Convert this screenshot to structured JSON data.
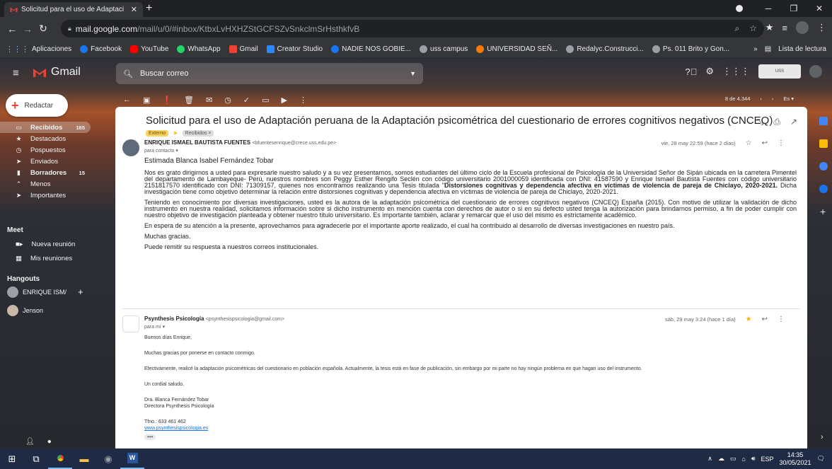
{
  "browser": {
    "tab_title": "Solicitud para el uso de Adaptaci",
    "tab_close": "✕",
    "new_tab": "+",
    "url_host": "mail.google.com",
    "url_path": "/mail/u/0/#inbox/KtbxLvHXHZStGCFSZvSnkclmSrHsthkfvB",
    "bookmarks": [
      {
        "label": "Aplicaciones",
        "color": "#fbbc04"
      },
      {
        "label": "Facebook",
        "color": "#1877f2"
      },
      {
        "label": "YouTube",
        "color": "#ff0000"
      },
      {
        "label": "WhatsApp",
        "color": "#25d366"
      },
      {
        "label": "Gmail",
        "color": "#ea4335"
      },
      {
        "label": "Creator Studio",
        "color": "#2d88ff"
      },
      {
        "label": "NADIE NOS GOBIE...",
        "color": "#1877f2"
      },
      {
        "label": "uss campus",
        "color": "#9aa0a6"
      },
      {
        "label": "UNIVERSIDAD SEÑ...",
        "color": "#f57c00"
      },
      {
        "label": "Redalyc.Construcci...",
        "color": "#9aa0a6"
      },
      {
        "label": "Ps. 011 Brito y Gon...",
        "color": "#9aa0a6"
      }
    ],
    "bookmarks_more": "»",
    "reading_list": "Lista de lectura"
  },
  "gmail": {
    "app_name": "Gmail",
    "search_placeholder": "Buscar correo",
    "compose": "Redactar",
    "nav": [
      {
        "label": "Recibidos",
        "count": "165",
        "icon": "inbox-icon",
        "glyph": "▭",
        "active": true
      },
      {
        "label": "Destacados",
        "count": "",
        "icon": "star-icon",
        "glyph": "★",
        "active": false
      },
      {
        "label": "Pospuestos",
        "count": "",
        "icon": "snooze-icon",
        "glyph": "◷",
        "active": false
      },
      {
        "label": "Enviados",
        "count": "",
        "icon": "send-icon",
        "glyph": "➤",
        "active": false
      },
      {
        "label": "Borradores",
        "count": "15",
        "icon": "draft-icon",
        "glyph": "▮",
        "active": false
      },
      {
        "label": "Menos",
        "count": "",
        "icon": "chevron-up-icon",
        "glyph": "⌃",
        "active": false
      },
      {
        "label": "Importantes",
        "count": "",
        "icon": "important-icon",
        "glyph": "➤",
        "active": false
      }
    ],
    "meet_title": "Meet",
    "meet_new": "Nueva reunión",
    "meet_mine": "Mis reuniones",
    "hangouts_title": "Hangouts",
    "hangouts_user": "ENRIQUE ISM/",
    "hangouts_contact": "Jenson",
    "pager_text": "8 de 4.344",
    "lang": "Es"
  },
  "email": {
    "subject": "Solicitud para el uso de Adaptación peruana de la Adaptación psicométrica del cuestionario de errores cognitivos negativos (CNCEQ)",
    "label_external": "Externo",
    "label_inbox": "Recibidos ×",
    "m1": {
      "sender": "ENRIQUE ISMAEL BAUTISTA FUENTES",
      "email": "<bfuentesenrique@crece.uss.edu.pe>",
      "to": "para contacto ▾",
      "date": "vie, 28 may 22:59 (hace 2 días)",
      "greeting": "Estimada Blanca Isabel Fernández Tobar",
      "p1_a": "Nos es grato dirigirnos a usted para expresarle nuestro saludo y a su vez presentarnos, somos estudiantes del último ciclo de la Escuela profesional de Psicología de la Universidad Señor de Sipán ubicada en la carretera Pimentel del departamento de Lambayeque- Perú, nuestros nombres son Peggy Esther Rengifo Seclén con código universitario 2001000059 identificada con DNI: 41587590  y Enrique Ismael Bautista Fuentes con código universitario 2151817570 identificado con DNI: 71309157, quienes nos encontramos realizando una Tesis titulada \"",
      "p1_b": "Distorsiones cognitivas y dependencia afectiva en víctimas de violencia de pareja de Chiclayo, 2020-2021.",
      "p1_c": " Dicha investigación tiene como objetivo determinar la relación entre distorsiones cognitivas y dependencia afectiva en víctimas de violencia de pareja de Chiclayo, 2020-2021.",
      "p2": "Teniendo en conocimiento por diversas investigaciones, usted es la autora de la adaptación psicométrica del cuestionario de errores cognitivos negativos (CNCEQ) España (2015). Con motivo de utilizar la validación de dicho instrumento en nuestra realidad, solicitamos información sobre si dicho instrumento en mención cuenta con derechos de autor o si en su defecto usted tenga la autorización para brindarnos permiso, a fin de poder cumplir con nuestro objetivo de investigación planteada y obtener nuestro título universitario. Es importante también, aclarar y remarcar que el uso del mismo es estrictamente académico.",
      "p3": "En espera de su atención a la presente, aprovechamos para agradecerle por el importante aporte realizado, el cual ha contribuido al desarrollo de diversas investigaciones en nuestro país.",
      "p4": "Muchas gracias.",
      "p5": "Puede remitir su respuesta a nuestros correos institucionales."
    },
    "m2": {
      "sender": "Psynthesis Psicología",
      "email": "<psynthesispsicologia@gmail.com>",
      "to": "para mí ▾",
      "date": "sáb, 29 may 3:24 (hace 1 día)",
      "p1": "Buenos días Enrique,",
      "p2": "Muchas gracias por ponerse en contacto conmigo.",
      "p3": "Efectivamente, realicé la adaptación psicométricas del cuestionario en población española. Actualmente, la tesis está en fase de publicación, sin embargo por mi parte no hay ningún problema en que hagan uso del instrumento.",
      "p4": "Un cordial saludo,",
      "sig1": "Dra. Blanca Fernández Tobar",
      "sig2": "Directora Psynthesis Psicología",
      "phone": "Tfno.: 633 461 462",
      "web": "www.psynthesispsicologia.es",
      "more": "•••"
    }
  },
  "taskbar": {
    "lang": "ESP",
    "time": "14:35",
    "date": "30/05/2021"
  }
}
